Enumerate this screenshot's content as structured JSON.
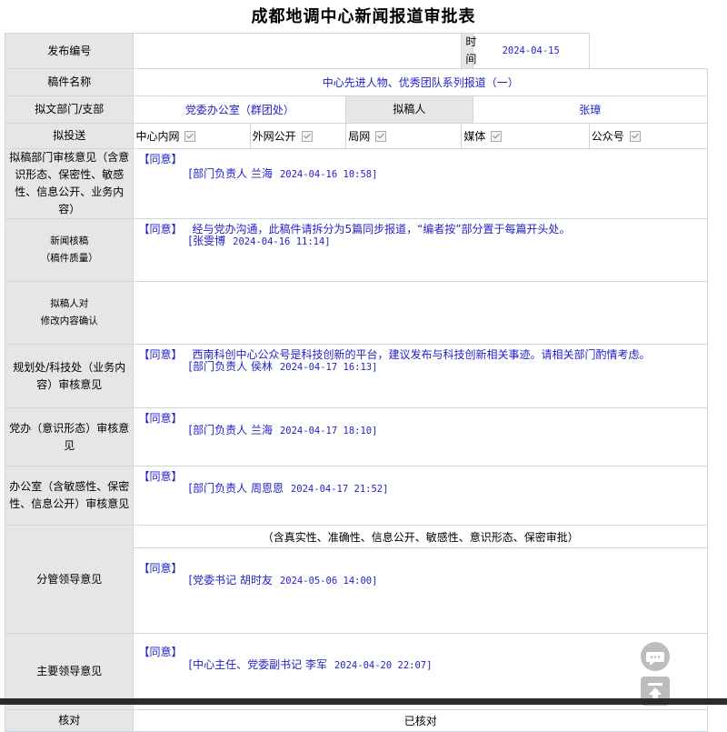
{
  "page_title": "成都地调中心新闻报道审批表",
  "fields": {
    "publish_no_label": "发布编号",
    "publish_no_value": "",
    "time_label": "时间",
    "time_value": "2024-04-15",
    "manuscript_label": "稿件名称",
    "manuscript_value": "中心先进人物、优秀团队系列报道（一）",
    "dept_label": "拟文部门/支部",
    "dept_value": "党委办公室（群团处）",
    "drafter_label": "拟稿人",
    "drafter_value": "张璋"
  },
  "send": {
    "label": "拟投送",
    "options": [
      {
        "label": "中心内网",
        "checked": true
      },
      {
        "label": "外网公开",
        "checked": true
      },
      {
        "label": "局网",
        "checked": true
      },
      {
        "label": "媒体",
        "checked": true
      },
      {
        "label": "公众号",
        "checked": true
      }
    ]
  },
  "opinions": [
    {
      "label": "拟稿部门审核意见（含意识形态、保密性、敏感性、信息公开、业务内容）",
      "agree": "【同意】",
      "text": "",
      "sign": "[部门负责人 兰海",
      "time": "2024-04-16 10:58]"
    },
    {
      "label1": "新闻核稿",
      "label2": "（稿件质量）",
      "agree": "【同意】",
      "text": "经与党办沟通，此稿件请拆分为5篇同步报道，“编者按”部分置于每篇开头处。",
      "sign": "[张雯博",
      "time": "2024-04-16 11:14]"
    },
    {
      "label1": "拟稿人对",
      "label2": "修改内容确认",
      "agree": "",
      "text": "",
      "sign": "",
      "time": ""
    },
    {
      "label": "规划处/科技处（业务内容）审核意见",
      "agree": "【同意】",
      "text": "西南科创中心公众号是科技创新的平台，建议发布与科技创新相关事迹。请相关部门酌情考虑。",
      "sign": "[部门负责人 侯林",
      "time": "2024-04-17 16:13]"
    },
    {
      "label": "党办（意识形态）审核意见",
      "agree": "【同意】",
      "text": "",
      "sign": "[部门负责人 兰海",
      "time": "2024-04-17 18:10]"
    },
    {
      "label": "办公室（含敏感性、保密性、信息公开）审核意见",
      "agree": "【同意】",
      "text": "",
      "sign": "[部门负责人 周恩恩",
      "time": "2024-04-17 21:52]"
    },
    {
      "label": "分管领导意见",
      "note": "（含真实性、准确性、信息公开、敏感性、意识形态、保密审批）",
      "agree": "【同意】",
      "text": "",
      "sign": "[党委书记 胡时友",
      "time": "2024-05-06 14:00]"
    },
    {
      "label": "主要领导意见",
      "agree": "【同意】",
      "text": "",
      "sign": "[中心主任、党委副书记 李军",
      "time": "2024-04-20 22:07]"
    }
  ],
  "last_row": {
    "label": "核对",
    "value": "已核对"
  },
  "floating": {
    "comment_icon": "comment-icon",
    "top_icon": "back-to-top-icon"
  }
}
